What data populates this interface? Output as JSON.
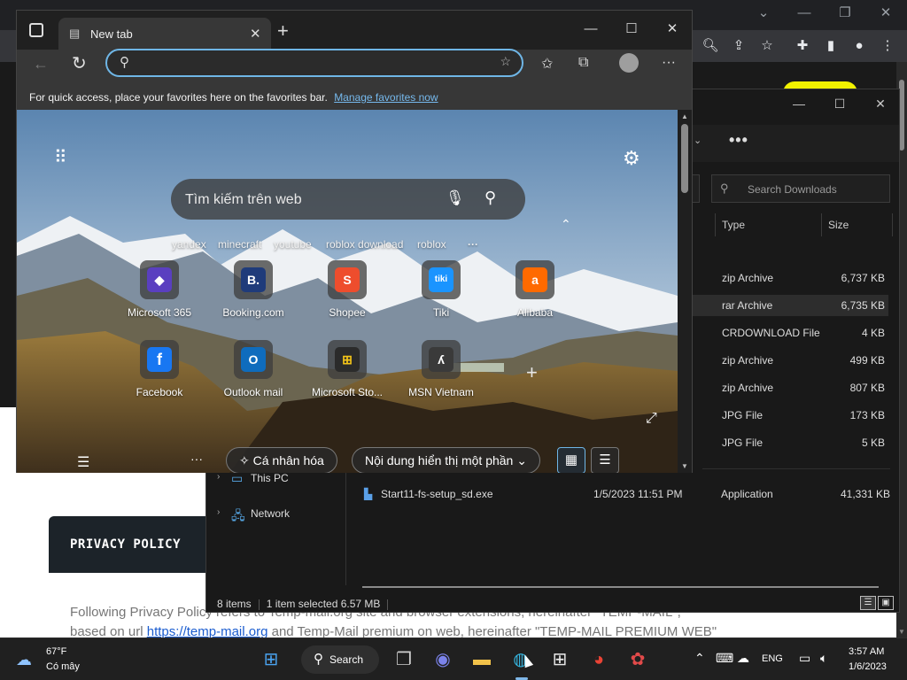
{
  "privacy": {
    "title": "PRIVACY POLICY",
    "line1": "Following Privacy Policy refers to Temp-mail.org site and browser extensions, hereinafter \"TEMP-MAIL\",",
    "line2_pre": "based on url ",
    "line2_link": "https://temp-mail.org",
    "line2_post": " and Temp-Mail premium on web, hereinafter \"TEMP-MAIL PREMIUM WEB\""
  },
  "edge": {
    "tab_title": "New tab",
    "favbar_text": "For quick access, place your favorites here on the favorites bar.",
    "favbar_link": "Manage favorites now",
    "search_placeholder": "Tìm kiếm trên web",
    "suggestions": [
      "yandex",
      "minecraft",
      "youtube",
      "roblox download",
      "roblox"
    ],
    "tiles_row1": [
      {
        "label": "Microsoft 365",
        "icon": "microsoft-365-icon",
        "color": "#5a3fc0",
        "glyph": "◆"
      },
      {
        "label": "Booking.com",
        "icon": "booking-icon",
        "color": "#1f3b7a",
        "glyph": "B."
      },
      {
        "label": "Shopee",
        "icon": "shopee-icon",
        "color": "#ee4d2d",
        "glyph": "S"
      },
      {
        "label": "Tiki",
        "icon": "tiki-icon",
        "color": "#1a94ff",
        "glyph": "tiki"
      },
      {
        "label": "Alibaba",
        "icon": "alibaba-icon",
        "color": "#ff6a00",
        "glyph": "a"
      }
    ],
    "tiles_row2": [
      {
        "label": "Facebook",
        "icon": "facebook-icon",
        "color": "#1877f2",
        "glyph": "f"
      },
      {
        "label": "Outlook mail",
        "icon": "outlook-icon",
        "color": "#0f6cbd",
        "glyph": "O"
      },
      {
        "label": "Microsoft Sto...",
        "icon": "microsoft-store-icon",
        "color": "#2b2b2b",
        "glyph": "⊞"
      },
      {
        "label": "MSN Vietnam",
        "icon": "msn-icon",
        "color": "#3a3a3a",
        "glyph": "ʎ"
      }
    ],
    "personalize_label": "Cá nhân hóa",
    "content_label": "Nội dung hiển thị một phần"
  },
  "explorer": {
    "search_placeholder": "Search Downloads",
    "col_type": "Type",
    "col_size": "Size",
    "rows": [
      {
        "type": "zip Archive",
        "size": "6,737 KB"
      },
      {
        "type": "rar Archive",
        "size": "6,735 KB"
      },
      {
        "type": "CRDOWNLOAD File",
        "size": "4 KB"
      },
      {
        "type": "zip Archive",
        "size": "499 KB"
      },
      {
        "type": "zip Archive",
        "size": "807 KB"
      },
      {
        "type": "JPG File",
        "size": "173 KB"
      },
      {
        "type": "JPG File",
        "size": "5 KB"
      }
    ],
    "nav_this_pc": "This PC",
    "nav_network": "Network",
    "file_name": "Start11-fs-setup_sd.exe",
    "file_date": "1/5/2023 11:51 PM",
    "file_type": "Application",
    "file_size": "41,331 KB",
    "status_items": "8 items",
    "status_selected": "1 item selected  6.57 MB"
  },
  "taskbar": {
    "temp": "67°F",
    "condition": "Có mây",
    "search_label": "Search",
    "lang": "ENG",
    "time": "3:57 AM",
    "date": "1/6/2023"
  }
}
